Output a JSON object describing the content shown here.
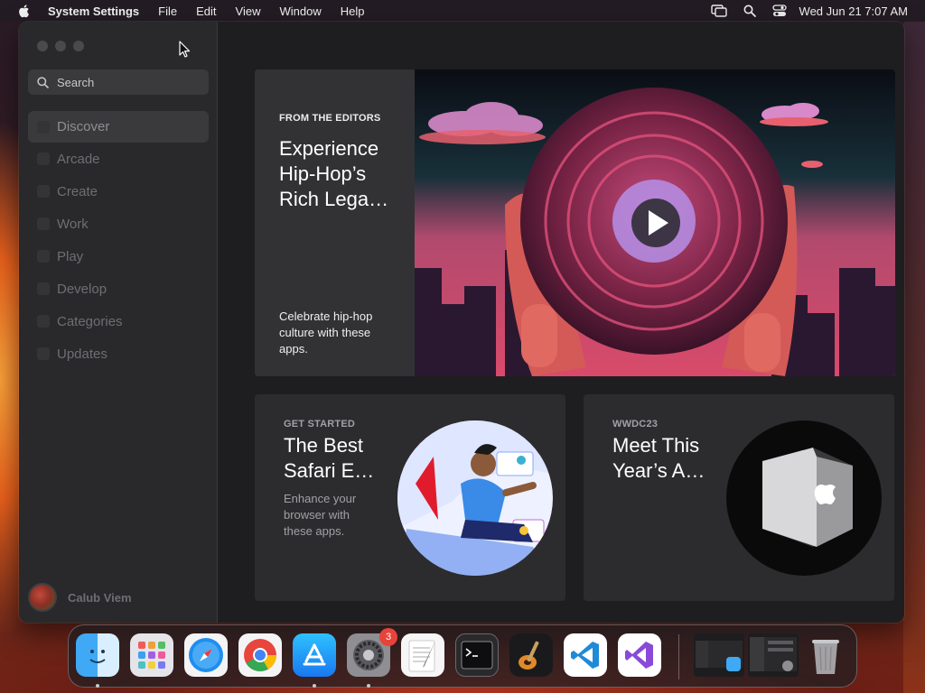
{
  "menubar": {
    "app_name": "System Settings",
    "items": [
      "File",
      "Edit",
      "View",
      "Window",
      "Help"
    ],
    "clock": "Wed Jun 21  7:07 AM"
  },
  "sidebar": {
    "search_placeholder": "Search",
    "items": [
      {
        "label": "Discover",
        "active": true
      },
      {
        "label": "Arcade"
      },
      {
        "label": "Create"
      },
      {
        "label": "Work"
      },
      {
        "label": "Play"
      },
      {
        "label": "Develop"
      },
      {
        "label": "Categories"
      },
      {
        "label": "Updates"
      }
    ],
    "user_name": "Calub Viem"
  },
  "hero": {
    "eyebrow": "FROM THE EDITORS",
    "title": "Experience Hip-Hop’s Rich Lega…",
    "subtitle": "Celebrate hip-hop culture with these apps."
  },
  "cards": [
    {
      "eyebrow": "GET STARTED",
      "title": "The Best Safari E…",
      "subtitle": "Enhance your browser with these apps."
    },
    {
      "eyebrow": "WWDC23",
      "title": "Meet This Year’s A…",
      "subtitle": ""
    }
  ],
  "dock": {
    "apps": [
      "finder",
      "launchpad",
      "safari",
      "chrome",
      "app-store",
      "system-settings",
      "textedit",
      "terminal",
      "garageband",
      "vscode",
      "visual-studio",
      "window-preview-1",
      "window-preview-2",
      "trash"
    ],
    "settings_badge": "3"
  },
  "colors": {
    "window_bg": "#1d1d1f",
    "sidebar_bg": "#29292b",
    "card_bg": "#2c2c2e",
    "badge": "#e8433a"
  }
}
